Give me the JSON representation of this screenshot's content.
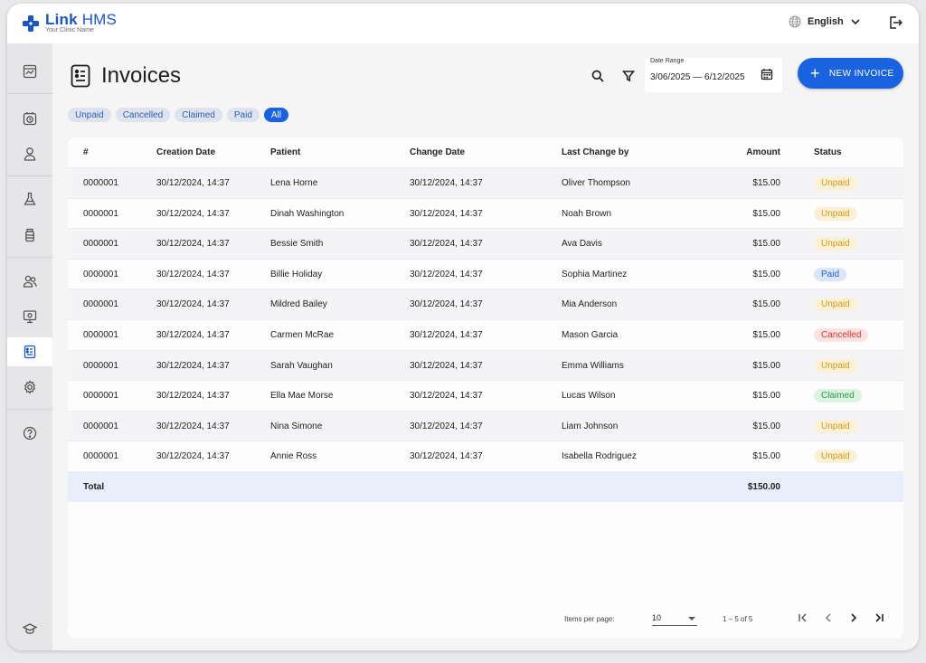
{
  "app": {
    "name_bold": "Link",
    "name_light": "HMS",
    "subtitle": "Your Clinic Name"
  },
  "header": {
    "language": "English"
  },
  "page": {
    "title": "Invoices"
  },
  "date_range": {
    "label": "Date Range",
    "value": "3/06/2025 — 6/12/2025"
  },
  "actions": {
    "new_invoice_label": "NEW INVOICE"
  },
  "filters": [
    {
      "label": "Unpaid",
      "active": false
    },
    {
      "label": "Cancelled",
      "active": false
    },
    {
      "label": "Claimed",
      "active": false
    },
    {
      "label": "Paid",
      "active": false
    },
    {
      "label": "All",
      "active": true
    }
  ],
  "table": {
    "columns": [
      "#",
      "Creation Date",
      "Patient",
      "Change Date",
      "Last Change by",
      "Amount",
      "Status"
    ],
    "rows": [
      {
        "id": "0000001",
        "created": "30/12/2024, 14:37",
        "patient": "Lena Horne",
        "changed": "30/12/2024, 14:37",
        "by": "Oliver Thompson",
        "amount": "$15.00",
        "status": "Unpaid"
      },
      {
        "id": "0000001",
        "created": "30/12/2024, 14:37",
        "patient": "Dinah Washington",
        "changed": "30/12/2024, 14:37",
        "by": "Noah Brown",
        "amount": "$15.00",
        "status": "Unpaid"
      },
      {
        "id": "0000001",
        "created": "30/12/2024, 14:37",
        "patient": "Bessie Smith",
        "changed": "30/12/2024, 14:37",
        "by": "Ava Davis",
        "amount": "$15.00",
        "status": "Unpaid"
      },
      {
        "id": "0000001",
        "created": "30/12/2024, 14:37",
        "patient": "Billie Holiday",
        "changed": "30/12/2024, 14:37",
        "by": "Sophia Martinez",
        "amount": "$15.00",
        "status": "Paid"
      },
      {
        "id": "0000001",
        "created": "30/12/2024, 14:37",
        "patient": "Mildred Bailey",
        "changed": "30/12/2024, 14:37",
        "by": "Mia Anderson",
        "amount": "$15.00",
        "status": "Unpaid"
      },
      {
        "id": "0000001",
        "created": "30/12/2024, 14:37",
        "patient": "Carmen McRae",
        "changed": "30/12/2024, 14:37",
        "by": "Mason Garcia",
        "amount": "$15.00",
        "status": "Cancelled"
      },
      {
        "id": "0000001",
        "created": "30/12/2024, 14:37",
        "patient": "Sarah Vaughan",
        "changed": "30/12/2024, 14:37",
        "by": "Emma Williams",
        "amount": "$15.00",
        "status": "Unpaid"
      },
      {
        "id": "0000001",
        "created": "30/12/2024, 14:37",
        "patient": "Ella Mae Morse",
        "changed": "30/12/2024, 14:37",
        "by": "Lucas Wilson",
        "amount": "$15.00",
        "status": "Claimed"
      },
      {
        "id": "0000001",
        "created": "30/12/2024, 14:37",
        "patient": "Nina Simone",
        "changed": "30/12/2024, 14:37",
        "by": "Liam Johnson",
        "amount": "$15.00",
        "status": "Unpaid"
      },
      {
        "id": "0000001",
        "created": "30/12/2024, 14:37",
        "patient": "Annie Ross",
        "changed": "30/12/2024, 14:37",
        "by": "Isabella Rodriguez",
        "amount": "$15.00",
        "status": "Unpaid"
      }
    ],
    "total": {
      "label": "Total",
      "amount": "$150.00"
    }
  },
  "pagination": {
    "items_per_page_label": "Items per page:",
    "page_size": "10",
    "range": "1 – 5 of 5"
  },
  "colors": {
    "accent": "#1a63e0",
    "brand": "#1a56c9",
    "unpaid": "#d49a16",
    "paid": "#2463d6",
    "cancelled": "#d63434",
    "claimed": "#2f9b4c"
  }
}
